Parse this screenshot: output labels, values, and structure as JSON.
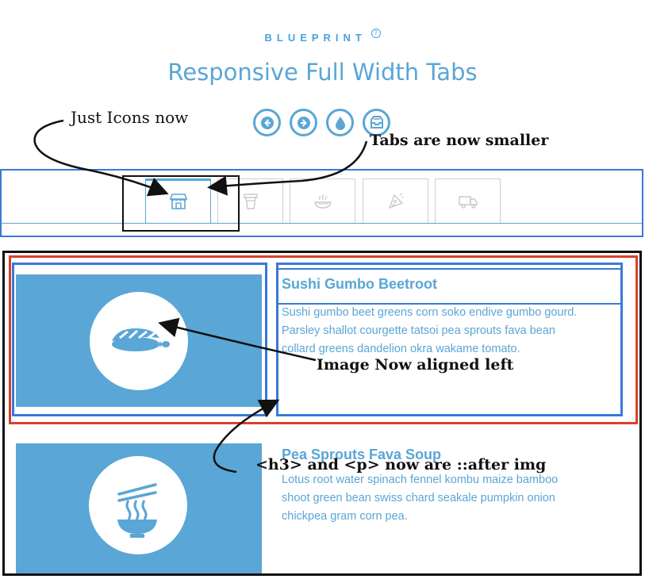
{
  "header": {
    "brand": "BLUEPRINT",
    "help_mark": "?",
    "title": "Responsive Full Width Tabs"
  },
  "nav_buttons": [
    {
      "icon": "arrow-left-icon"
    },
    {
      "icon": "arrow-right-icon"
    },
    {
      "icon": "drop-icon"
    },
    {
      "icon": "inbox-icon"
    }
  ],
  "annotations": {
    "just_icons": "Just Icons now",
    "tabs_smaller": "Tabs are now smaller",
    "image_aligned": "Image Now aligned left",
    "after_img": "<h3> and <p> now are ::after img"
  },
  "tabs": [
    {
      "icon": "shop-icon",
      "active": true
    },
    {
      "icon": "cup-icon",
      "active": false
    },
    {
      "icon": "food-bowl-icon",
      "active": false
    },
    {
      "icon": "pizza-slice-icon",
      "active": false
    },
    {
      "icon": "truck-icon",
      "active": false
    }
  ],
  "items": [
    {
      "title": "Sushi Gumbo Beetroot",
      "text_lines": [
        "Sushi gumbo beet greens corn soko endive gumbo gourd.",
        "Parsley shallot courgette tatsoi pea sprouts fava bean",
        "collard greens dandelion okra wakame tomato."
      ],
      "icon": "sushi-icon"
    },
    {
      "title": "Pea Sprouts Fava Soup",
      "text_lines": [
        "Lotus root water spinach fennel kombu maize bamboo",
        "shoot green bean swiss chard seakale pumpkin onion",
        "chickpea gram corn pea."
      ],
      "icon": "noodle-bowl-icon"
    }
  ],
  "colors": {
    "accent": "#5aa6d6",
    "annotation_blue": "#3a78d8",
    "annotation_red": "#d9402b",
    "annotation_black": "#111111"
  }
}
